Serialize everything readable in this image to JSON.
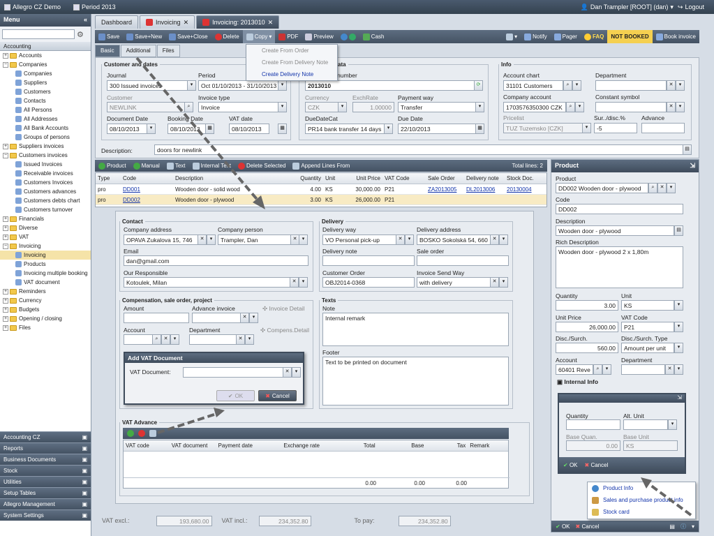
{
  "topbar": {
    "app": "Allegro CZ Demo",
    "period": "Period 2013",
    "user": "Dan Trampler [ROOT] (dan)",
    "logout": "Logout"
  },
  "sidebar": {
    "title": "Menu",
    "root": "Accounting",
    "items": [
      {
        "label": "Accounts",
        "lvl": 1,
        "t": "f"
      },
      {
        "label": "Companies",
        "lvl": 1,
        "t": "f",
        "open": true
      },
      {
        "label": "Companies",
        "lvl": 2,
        "t": "i"
      },
      {
        "label": "Suppliers",
        "lvl": 2,
        "t": "i"
      },
      {
        "label": "Customers",
        "lvl": 2,
        "t": "i"
      },
      {
        "label": "Contacts",
        "lvl": 2,
        "t": "i"
      },
      {
        "label": "All Persons",
        "lvl": 2,
        "t": "i"
      },
      {
        "label": "All Addresses",
        "lvl": 2,
        "t": "i"
      },
      {
        "label": "All Bank Accounts",
        "lvl": 2,
        "t": "i"
      },
      {
        "label": "Groups of persons",
        "lvl": 2,
        "t": "i"
      },
      {
        "label": "Suppliers invoices",
        "lvl": 1,
        "t": "f"
      },
      {
        "label": "Customers invoices",
        "lvl": 1,
        "t": "f",
        "open": true
      },
      {
        "label": "Issued Invoices",
        "lvl": 2,
        "t": "i"
      },
      {
        "label": "Receivable invoices",
        "lvl": 2,
        "t": "i"
      },
      {
        "label": "Customers Invoices",
        "lvl": 2,
        "t": "i"
      },
      {
        "label": "Customers advances",
        "lvl": 2,
        "t": "i"
      },
      {
        "label": "Customers debts chart",
        "lvl": 2,
        "t": "i"
      },
      {
        "label": "Customers turnover",
        "lvl": 2,
        "t": "i"
      },
      {
        "label": "Financials",
        "lvl": 1,
        "t": "f"
      },
      {
        "label": "Diverse",
        "lvl": 1,
        "t": "f"
      },
      {
        "label": "VAT",
        "lvl": 1,
        "t": "f"
      },
      {
        "label": "Invoicing",
        "lvl": 1,
        "t": "f",
        "open": true
      },
      {
        "label": "Invoicing",
        "lvl": 2,
        "t": "i",
        "sel": true
      },
      {
        "label": "Products",
        "lvl": 2,
        "t": "i"
      },
      {
        "label": "Invoicing multiple booking",
        "lvl": 2,
        "t": "i"
      },
      {
        "label": "VAT document",
        "lvl": 2,
        "t": "i"
      },
      {
        "label": "Reminders",
        "lvl": 1,
        "t": "f"
      },
      {
        "label": "Currency",
        "lvl": 1,
        "t": "f"
      },
      {
        "label": "Budgets",
        "lvl": 1,
        "t": "f"
      },
      {
        "label": "Opening / closing",
        "lvl": 1,
        "t": "f"
      },
      {
        "label": "Files",
        "lvl": 1,
        "t": "f"
      }
    ],
    "sections": [
      "Accounting CZ",
      "Reports",
      "Business Documents",
      "Stock",
      "Utilities",
      "Setup Tables",
      "Allegro Management",
      "System Settings"
    ]
  },
  "tabs": [
    "Dashboard",
    "Invoicing",
    "Invoicing: 2013010"
  ],
  "toolbar": {
    "save": "Save",
    "save_new": "Save+New",
    "save_close": "Save+Close",
    "delete": "Delete",
    "copy": "Copy",
    "pdf": "PDF",
    "preview": "Preview",
    "cash": "Cash",
    "notify": "Notify",
    "pager": "Pager",
    "faq": "FAQ",
    "not_booked": "NOT BOOKED",
    "book": "Book invoice"
  },
  "copy_menu": [
    "Create From Order",
    "Create From Delivery Note",
    "Create Delivery Note"
  ],
  "subtabs": [
    "Basic",
    "Additional",
    "Files"
  ],
  "customer": {
    "legend": "Customer and dates",
    "journal_l": "Journal",
    "journal": "300 Issued invoices",
    "period_l": "Period",
    "period": "Oct 01/10/2013 - 31/10/2013",
    "customer_l": "Customer",
    "customer": "NEWLINK",
    "invtype_l": "Invoice type",
    "invtype": "Invoice",
    "docdate_l": "Document Date",
    "docdate": "08/10/2013",
    "bookdate_l": "Booking Date",
    "bookdate": "08/10/2013",
    "vatdate_l": "VAT date",
    "vatdate": "08/10/2013"
  },
  "payment": {
    "legend": "nd payment data",
    "number_l": "number",
    "number": "2013010",
    "currency_l": "Currency",
    "currency": "CZK",
    "exch_l": "ExchRate",
    "exch": "1.00000",
    "payway_l": "Payment way",
    "payway": "Transfer",
    "duecat_l": "DueDateCat",
    "duecat": "PR14 bank transfer 14 days",
    "duedate_l": "Due Date",
    "duedate": "22/10/2013"
  },
  "info": {
    "legend": "Info",
    "chart_l": "Account chart",
    "chart": "31101 Customers",
    "dept_l": "Department",
    "compacc_l": "Company account",
    "compacc": "1703576350300 CZK",
    "const_l": "Constant symbol",
    "price_l": "Pricelist",
    "price": "TUZ Tuzemsko [CZK]",
    "sur_l": "Sur../disc.%",
    "sur": "-5",
    "adv_l": "Advance"
  },
  "description": {
    "label": "Description:",
    "value": "doors for newlink"
  },
  "lines": {
    "toolbar": [
      "Product",
      "Manual",
      "Text",
      "Internal Text",
      "Delete Selected",
      "Append Lines From"
    ],
    "total": "Total lines: 2",
    "headers": [
      "Type",
      "Code",
      "Description",
      "Quantity",
      "Unit",
      "Unit Price",
      "VAT Code",
      "Sale Order",
      "Delivery note",
      "Stock Doc."
    ],
    "rows": [
      [
        "pro",
        "DD001",
        "Wooden door - solid wood",
        "4.00",
        "KS",
        "30,000.00",
        "P21",
        "ZA2013005",
        "DL2013006",
        "20130004"
      ],
      [
        "pro",
        "DD002",
        "Wooden door - plywood",
        "3.00",
        "KS",
        "26,000.00",
        "P21",
        "",
        "",
        ""
      ]
    ]
  },
  "contact": {
    "legend": "Contact",
    "addr_l": "Company address",
    "addr": "OPAVA  Zukalova 15, 746",
    "person_l": "Company person",
    "person": "Trampler, Dan",
    "email_l": "Email",
    "email": "dan@gmail.com",
    "resp_l": "Our Responsible",
    "resp": "Kotoulek, Milan"
  },
  "delivery": {
    "legend": "Delivery",
    "way_l": "Delivery way",
    "way": "VO   Personal pick-up",
    "addr_l": "Delivery address",
    "addr": "BOSKO  Sokolská 54, 660",
    "note_l": "Delivery note",
    "so_l": "Sale order",
    "co_l": "Customer Order",
    "co": "OBJ2014-0368",
    "send_l": "Invoice Send Way",
    "send": "with delivery"
  },
  "comp": {
    "legend": "Compensation, sale order, project",
    "amount_l": "Amount",
    "advinv_l": "Advance invoice",
    "invdet": "Invoice Detail",
    "acc_l": "Account",
    "dept_l": "Department",
    "compdet": "Compens.Detail"
  },
  "texts": {
    "legend": "Texts",
    "note_l": "Note",
    "note": "Internal remark",
    "footer_l": "Footer",
    "footer": "Text to be printed on document"
  },
  "vatdoc": {
    "title": "Add VAT Document",
    "label": "VAT Document:",
    "ok": "OK",
    "cancel": "Cancel"
  },
  "vatadv": {
    "legend": "VAT Advance",
    "headers": [
      "VAT code",
      "VAT document",
      "Payment date",
      "Exchange rate",
      "Total",
      "Base",
      "Tax",
      "Remark"
    ],
    "totals": [
      "0.00",
      "0.00",
      "0.00"
    ]
  },
  "totals": {
    "excl_l": "VAT excl.:",
    "excl": "193,680.00",
    "incl_l": "VAT incl.:",
    "incl": "234,352.80",
    "pay_l": "To pay:",
    "pay": "234,352.80"
  },
  "product": {
    "title": "Product",
    "prod_l": "Product",
    "prod": "DD002 Wooden door - plywood",
    "code_l": "Code",
    "code": "DD002",
    "desc_l": "Description",
    "desc": "Wooden door - plywood",
    "rich_l": "Rich Description",
    "rich": "Wooden door - plywood 2 x 1,80m",
    "qty_l": "Quantity",
    "qty": "3.00",
    "unit_l": "Unit",
    "unit": "KS",
    "price_l": "Unit Price",
    "price": "26,000.00",
    "vat_l": "VAT Code",
    "vat": "P21",
    "disc_l": "Disc./Surch.",
    "disc": "560.00",
    "disct_l": "Disc./Surch. Type",
    "disct": "Amount per unit",
    "acc_l": "Account",
    "acc": "60401 Reve",
    "dept_l": "Department",
    "intinfo": "Internal Info",
    "ok": "OK",
    "cancel": "Cancel"
  },
  "internal": {
    "qty_l": "Quantity",
    "alt_l": "Alt. Unit",
    "bq_l": "Base Quan.",
    "bq": "0.00",
    "bu_l": "Base Unit",
    "bu": "KS",
    "ok": "OK",
    "cancel": "Cancel"
  },
  "popup": [
    "Product Info",
    "Sales and purchase product info",
    "Stock card"
  ]
}
